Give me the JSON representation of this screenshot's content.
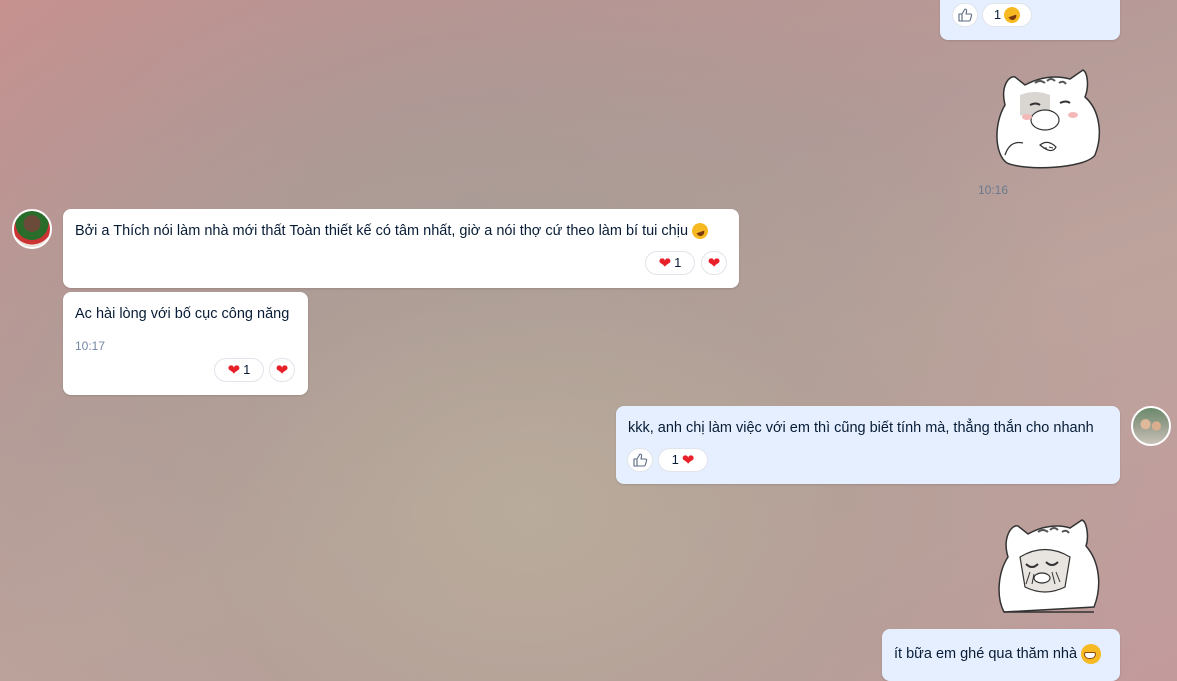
{
  "messages": [
    {
      "id": "m1",
      "side": "out",
      "reactions": {
        "like_icon": "like-icon",
        "count": "1",
        "emoji": "laughing-emoji"
      }
    },
    {
      "id": "m2",
      "side": "out",
      "type": "sticker",
      "sticker": "cat-sticker-blush",
      "time": "10:16"
    },
    {
      "id": "m3",
      "side": "in",
      "text": "Bởi a Thích nói làm nhà mới thất Toàn thiết kế có tâm nhất, giờ a nói thợ cứ theo làm bí tui chịu",
      "reactions": {
        "count": "1"
      }
    },
    {
      "id": "m4",
      "side": "in",
      "text": "Ac hài lòng với bố cục công năng",
      "time": "10:17",
      "reactions": {
        "count": "1"
      }
    },
    {
      "id": "m5",
      "side": "out",
      "text": "kkk, anh chị làm việc với em thì cũng biết tính mà, thẳng thắn cho nhanh",
      "reactions": {
        "count": "1"
      }
    },
    {
      "id": "m6",
      "side": "out",
      "type": "sticker",
      "sticker": "cat-sticker-crying"
    },
    {
      "id": "m7",
      "side": "out",
      "text": "ít bữa em ghé qua thăm nhà"
    }
  ],
  "colors": {
    "bubble_in": "#ffffff",
    "bubble_out": "#e5efff",
    "heart": "#e8202a"
  }
}
